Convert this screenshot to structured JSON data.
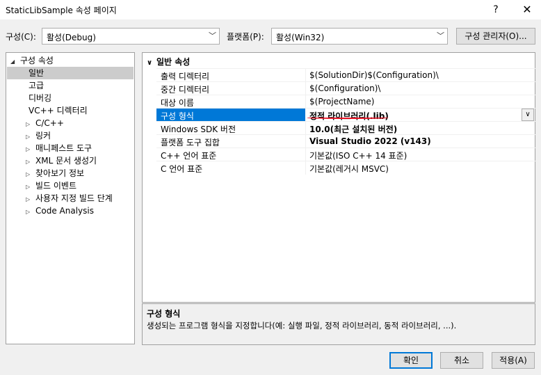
{
  "window": {
    "title": "StaticLibSample 속성 페이지",
    "help_label": "?",
    "close_label": "✕"
  },
  "config": {
    "label": "구성(C):",
    "value": "활성(Debug)"
  },
  "platform": {
    "label": "플랫폼(P):",
    "value": "활성(Win32)"
  },
  "config_manager_label": "구성 관리자(O)...",
  "tree": {
    "root": "구성 속성",
    "items": [
      {
        "label": "일반",
        "expandable": false,
        "selected": true
      },
      {
        "label": "고급",
        "expandable": false
      },
      {
        "label": "디버깅",
        "expandable": false
      },
      {
        "label": "VC++ 디렉터리",
        "expandable": false
      },
      {
        "label": "C/C++",
        "expandable": true
      },
      {
        "label": "링커",
        "expandable": true
      },
      {
        "label": "매니페스트 도구",
        "expandable": true
      },
      {
        "label": "XML 문서 생성기",
        "expandable": true
      },
      {
        "label": "찾아보기 정보",
        "expandable": true
      },
      {
        "label": "빌드 이벤트",
        "expandable": true
      },
      {
        "label": "사용자 지정 빌드 단계",
        "expandable": true
      },
      {
        "label": "Code Analysis",
        "expandable": true
      }
    ]
  },
  "grid": {
    "section_title": "일반 속성",
    "rows": [
      {
        "name": "출력 디렉터리",
        "value": "$(SolutionDir)$(Configuration)\\",
        "bold": false
      },
      {
        "name": "중간 디렉터리",
        "value": "$(Configuration)\\",
        "bold": false
      },
      {
        "name": "대상 이름",
        "value": "$(ProjectName)",
        "bold": false
      },
      {
        "name": "구성 형식",
        "value": "정적 라이브러리(.lib)",
        "bold": true,
        "selected": true
      },
      {
        "name": "Windows SDK 버전",
        "value": "10.0(최근 설치된 버전)",
        "bold": true
      },
      {
        "name": "플랫폼 도구 집합",
        "value": "Visual Studio 2022 (v143)",
        "bold": true
      },
      {
        "name": "C++ 언어 표준",
        "value": "기본값(ISO C++ 14 표준)",
        "bold": false
      },
      {
        "name": "C 언어 표준",
        "value": "기본값(레거시 MSVC)",
        "bold": false
      }
    ]
  },
  "description": {
    "title": "구성 형식",
    "text": "생성되는 프로그램 형식을 지정합니다(예: 실행 파일, 정적 라이브러리, 동적 라이브러리, ...)."
  },
  "buttons": {
    "ok": "확인",
    "cancel": "취소",
    "apply": "적용(A)"
  },
  "colors": {
    "selection_blue": "#0078d7",
    "underline_red": "#e81123"
  }
}
